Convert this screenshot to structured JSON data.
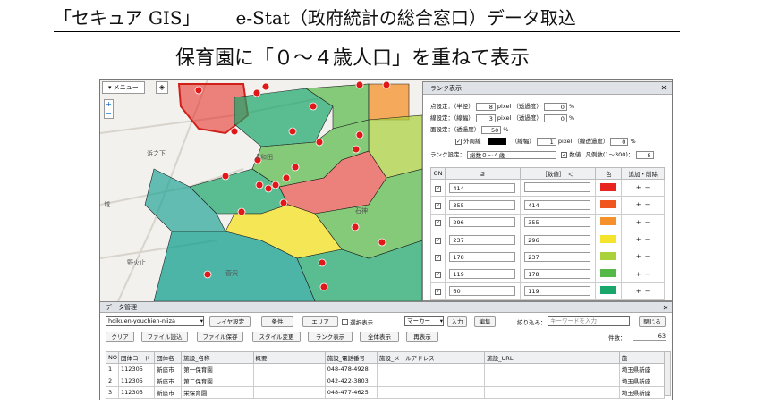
{
  "slide": {
    "title_part1": "「セキュア GIS」",
    "title_part2": "e-Stat（政府統計の総合窓口）データ取込",
    "subtitle": "保育園に「０～４歳人口」を重ねて表示"
  },
  "map": {
    "menu_label": "▾ メニュー",
    "zoom_in": "+",
    "zoom_out": "−",
    "labels": [
      "浜之下",
      "大和田",
      "城",
      "石神",
      "野火止",
      "菅沢"
    ]
  },
  "rank_panel": {
    "title": "ランク表示",
    "rows": {
      "point": {
        "label": "点設定：（半径）",
        "value": "8",
        "unit": "pixel （透過度）",
        "alpha": "0",
        "pct": "%"
      },
      "line": {
        "label": "線設定：（線幅）",
        "value": "3",
        "unit": "pixel （透過度）",
        "alpha": "0",
        "pct": "%"
      },
      "area": {
        "label": "面設定：（透過度）",
        "alpha": "50",
        "pct": "%"
      },
      "outline": {
        "label": "外周線",
        "width_label": "（線幅）",
        "width": "1",
        "unit": "pixel （線透過度）",
        "alpha": "0",
        "pct": "%"
      },
      "rank": {
        "label": "ランク設定：",
        "field": "総数０～４歳",
        "values_label": "数値",
        "count_label": "凡例数(1～300)：",
        "count": "8"
      }
    },
    "table_headers": [
      "ON",
      "≦",
      "［数値］",
      "＜",
      "色",
      "追加・削除"
    ],
    "table_rows": [
      {
        "low": "414",
        "high": "",
        "color": "#e8241e"
      },
      {
        "low": "355",
        "high": "414",
        "color": "#f2561f"
      },
      {
        "low": "296",
        "high": "355",
        "color": "#f5902a"
      },
      {
        "low": "237",
        "high": "296",
        "color": "#f5e42e"
      },
      {
        "low": "178",
        "high": "237",
        "color": "#a9d13b"
      },
      {
        "low": "119",
        "high": "178",
        "color": "#55b947"
      },
      {
        "low": "60",
        "high": "119",
        "color": "#1aa56a"
      },
      {
        "low": "",
        "high": "60",
        "color": "#14a090"
      }
    ],
    "add": "+",
    "remove": "−"
  },
  "data_panel": {
    "title": "データ管理",
    "layer_select": "hoikuen-youchien-niiza",
    "btn_layer": "レイヤ設定",
    "btn_condition": "条件",
    "btn_area": "エリア",
    "chk_select": "選択表示",
    "marker_select": "マーカー",
    "btn_input": "入力",
    "btn_edit": "編集",
    "filter_label": "絞り込み：",
    "filter_placeholder": "キーワードを入力",
    "btn_close": "閉じる",
    "btn_clear": "クリア",
    "btn_file_read": "ファイル読込",
    "btn_file_save": "ファイル保存",
    "btn_style": "スタイル変更",
    "btn_rank": "ランク表示",
    "btn_all": "全体表示",
    "btn_redraw": "再表示",
    "count_label": "件数：",
    "count_value": "63",
    "columns": [
      "NO",
      "団体コード",
      "団体名",
      "施設_名称",
      "概要",
      "施設_電話番号",
      "施設_メールアドレス",
      "施設_URL",
      "施"
    ],
    "rows": [
      [
        "1",
        "112305",
        "新座市",
        "第一保育園",
        "",
        "048-478-4928",
        "",
        "",
        "埼玉県新座"
      ],
      [
        "2",
        "112305",
        "新座市",
        "第二保育園",
        "",
        "042-422-3803",
        "",
        "",
        "埼玉県新座"
      ],
      [
        "3",
        "112305",
        "新座市",
        "栄保育園",
        "",
        "048-477-4625",
        "",
        "",
        "埼玉県新座"
      ]
    ]
  }
}
